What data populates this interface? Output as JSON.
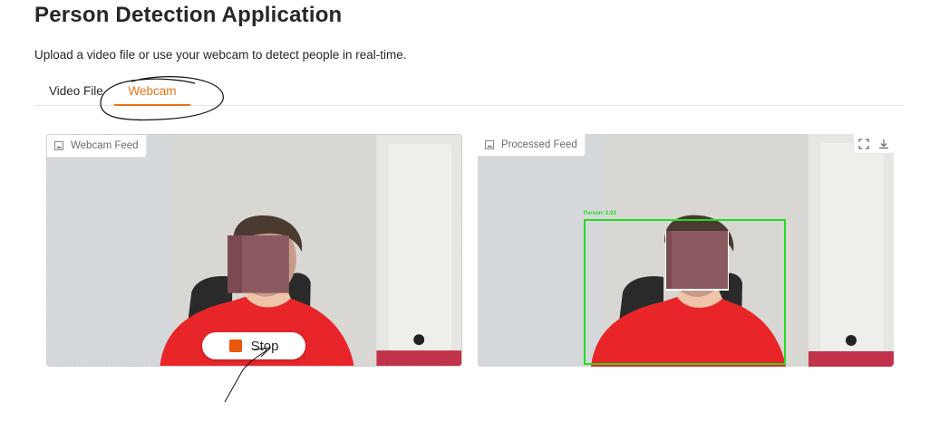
{
  "page": {
    "title": "Person Detection Application",
    "subtitle": "Upload a video file or use your webcam to detect people in real-time."
  },
  "tabs": [
    {
      "label": "Video File",
      "selected": false
    },
    {
      "label": "Webcam",
      "selected": true
    }
  ],
  "webcam_panel": {
    "label": "Webcam Feed",
    "label_icon": "image-icon",
    "stop_button": {
      "label": "Stop",
      "icon": "stop-square-icon"
    }
  },
  "processed_panel": {
    "label": "Processed Feed",
    "label_icon": "image-icon",
    "tools": [
      "fullscreen-icon",
      "download-icon"
    ],
    "detection": {
      "label": "Person: 0.93"
    }
  },
  "colors": {
    "accent": "#ea7317",
    "stop": "#ea580c",
    "detection_box": "#22dd22"
  }
}
